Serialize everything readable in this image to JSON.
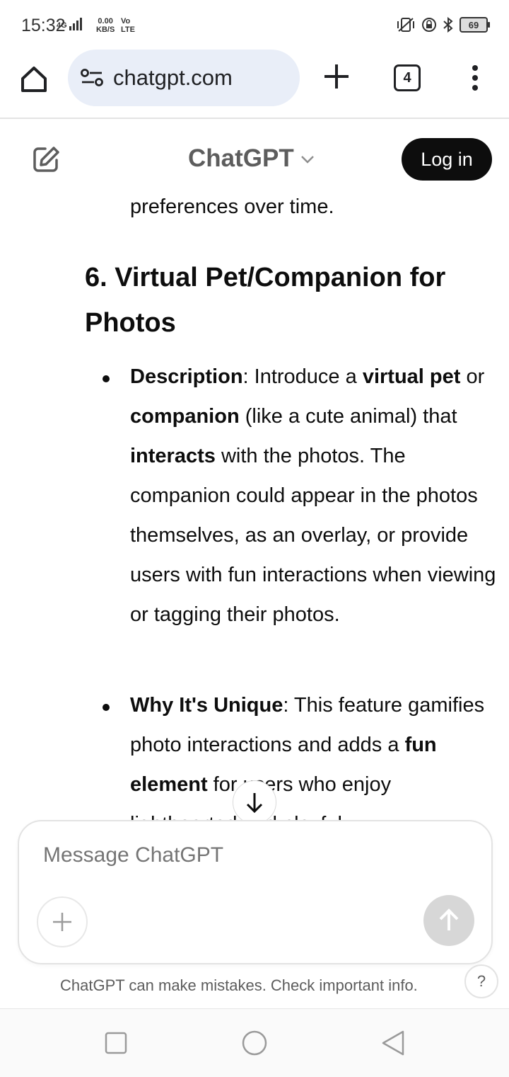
{
  "status_bar": {
    "time": "15:32",
    "network": "4G",
    "net_speed_value": "0.00",
    "net_speed_unit": "KB/S",
    "volte_top": "Vo",
    "volte_bottom": "LTE",
    "battery": "69"
  },
  "browser": {
    "url": "chatgpt.com",
    "tab_count": "4"
  },
  "header": {
    "title": "ChatGPT",
    "login_label": "Log in"
  },
  "content": {
    "continued_line": "preferences over time.",
    "heading": "6. Virtual Pet/Companion for Photos",
    "bullets": [
      {
        "label": "Description",
        "parts": [
          {
            "t": "Description",
            "b": true
          },
          {
            "t": ": Introduce a ",
            "b": false
          },
          {
            "t": "virtual pet",
            "b": true
          },
          {
            "t": " or ",
            "b": false
          },
          {
            "t": "companion",
            "b": true
          },
          {
            "t": " (like a cute animal) that ",
            "b": false
          },
          {
            "t": "interacts",
            "b": true
          },
          {
            "t": " with the photos. The companion could appear in the photos themselves, as an overlay, or provide users with fun interactions when viewing or tagging their photos.",
            "b": false
          }
        ]
      },
      {
        "label": "Why It's Unique",
        "parts": [
          {
            "t": "Why It's Unique",
            "b": true
          },
          {
            "t": ": This feature gamifies photo interactions and adds a ",
            "b": false
          },
          {
            "t": "fun element",
            "b": true
          },
          {
            "t": " for users who enjoy lighthearted and playful",
            "b": false
          }
        ]
      }
    ]
  },
  "composer": {
    "placeholder": "Message ChatGPT"
  },
  "footer": {
    "note": "ChatGPT can make mistakes. Check important info.",
    "help": "?"
  },
  "colors": {
    "accent": "#0d0d0d",
    "url_bg": "#e9eef8",
    "send_disabled": "#d7d7d7"
  }
}
